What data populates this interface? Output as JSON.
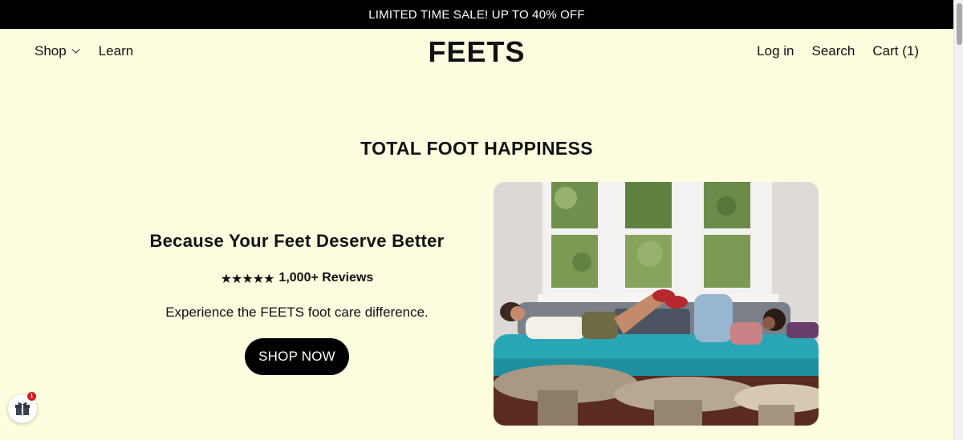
{
  "announcement": {
    "text": "LIMITED TIME SALE! UP TO 40% OFF"
  },
  "header": {
    "nav_left": {
      "shop": "Shop",
      "learn": "Learn"
    },
    "logo": "FEETS",
    "nav_right": {
      "login": "Log in",
      "search": "Search",
      "cart": "Cart (1)"
    }
  },
  "section": {
    "title": "TOTAL FOOT HAPPINESS"
  },
  "hero": {
    "heading": "Because Your Feet Deserve Better",
    "stars": "★★★★★",
    "reviews": "1,000+ Reviews",
    "subtext": "Experience the FEETS foot care difference.",
    "cta": "SHOP NOW",
    "image_description": "Two people lounging on a teal couch by windows with a wooden table in foreground"
  },
  "widgets": {
    "gift_badge_count": "1"
  },
  "colors": {
    "background": "#fefde0",
    "announcement_bg": "#000000",
    "button_bg": "#000000",
    "badge": "#d9151b"
  }
}
